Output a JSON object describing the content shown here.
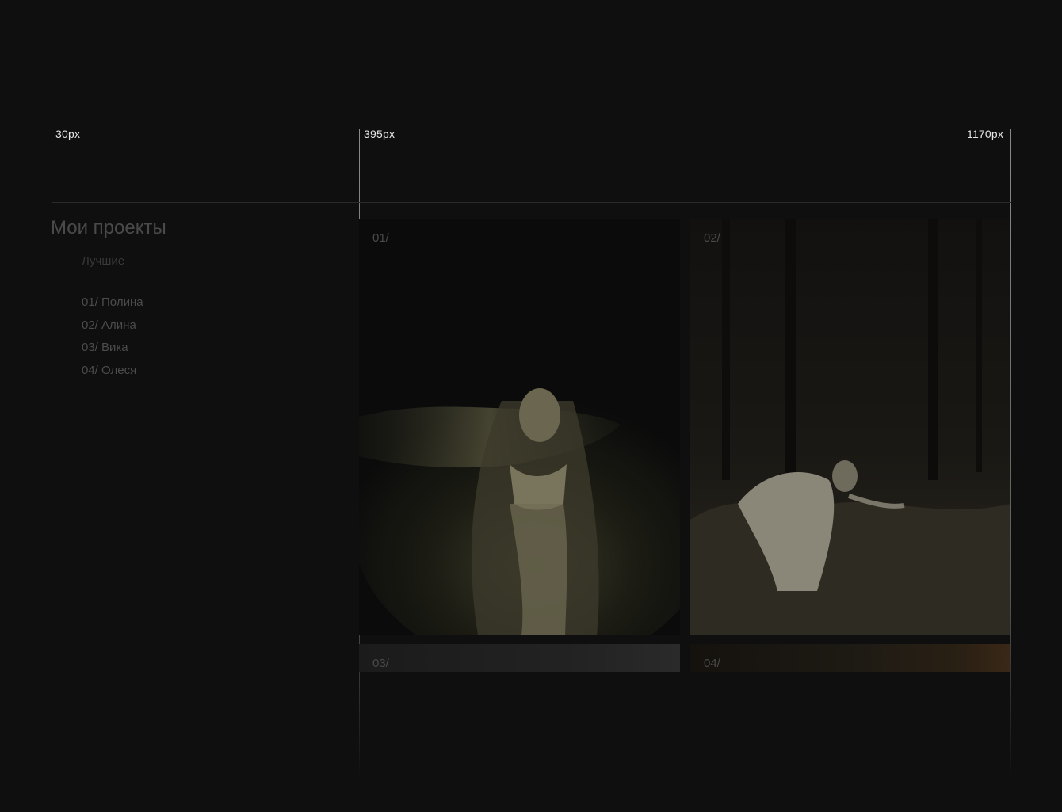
{
  "guides": [
    {
      "label": "30px"
    },
    {
      "label": "395px"
    },
    {
      "label": "1170px"
    }
  ],
  "sidebar": {
    "title": "Мои проекты",
    "filter_label": "Лучшие",
    "items": [
      {
        "label": "01/ Полина"
      },
      {
        "label": "02/ Алина"
      },
      {
        "label": "03/ Вика"
      },
      {
        "label": "04/ Олеся"
      }
    ]
  },
  "gallery": {
    "cards": [
      {
        "number": "01/"
      },
      {
        "number": "02/"
      },
      {
        "number": "03/"
      },
      {
        "number": "04/"
      }
    ]
  },
  "colors": {
    "background": "#0f0f0f",
    "guide_line": "#8a8a8a",
    "guide_label": "#e6e6e6",
    "muted_text": "#4a4a4a"
  }
}
